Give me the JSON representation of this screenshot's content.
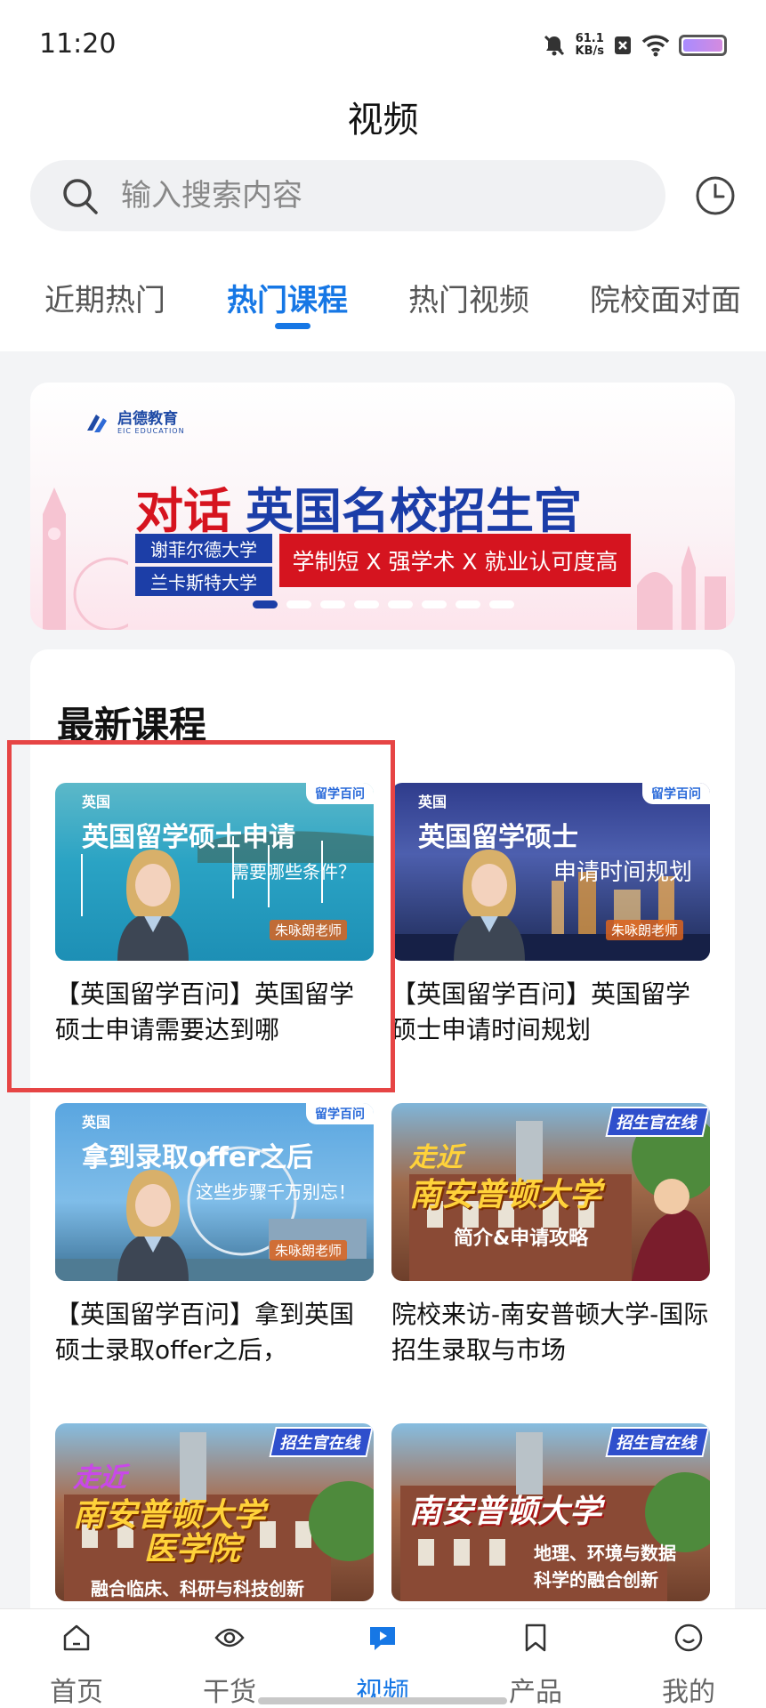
{
  "status_bar": {
    "time": "11:20",
    "net_speed_value": "61.1",
    "net_speed_unit": "KB/s"
  },
  "header": {
    "title": "视频"
  },
  "search": {
    "placeholder": "输入搜索内容"
  },
  "tabs": [
    {
      "label": "近期热门",
      "active": false
    },
    {
      "label": "热门课程",
      "active": true
    },
    {
      "label": "热门视频",
      "active": false
    },
    {
      "label": "院校面对面",
      "active": false
    }
  ],
  "banner": {
    "logo_text": "启德教育",
    "logo_sub": "EIC EDUCATION",
    "headline_red": "对话",
    "headline_blue": "英国名校招生官",
    "schools": [
      "谢菲尔德大学",
      "兰卡斯特大学"
    ],
    "slogan": "学制短 X 强学术 X 就业认可度高",
    "slide_count": 8,
    "active_slide": 1
  },
  "latest": {
    "section_title": "最新课程",
    "courses": [
      {
        "thumb_country": "英国",
        "thumb_corner": "留学百问",
        "thumb_headline": "英国留学硕士申请",
        "thumb_subline": "需要哪些条件？",
        "thumb_teacher": "朱咏朗老师",
        "title": "【英国留学百问】英国留学硕士申请需要达到哪"
      },
      {
        "thumb_country": "英国",
        "thumb_corner": "留学百问",
        "thumb_headline": "英国留学硕士",
        "thumb_subline": "申请时间规划",
        "thumb_teacher": "朱咏朗老师",
        "title": "【英国留学百问】英国留学硕士申请时间规划"
      },
      {
        "thumb_country": "英国",
        "thumb_corner": "留学百问",
        "thumb_headline": "拿到录取offer之后",
        "thumb_subline": "这些步骤千万别忘！",
        "thumb_teacher": "朱咏朗老师",
        "title": "【英国留学百问】拿到英国硕士录取offer之后，"
      },
      {
        "thumb_badge": "招生官在线",
        "thumb_line1": "走近",
        "thumb_line2": "南安普顿大学",
        "thumb_line3": "简介&申请攻略",
        "title": "院校来访-南安普顿大学-国际招生录取与市场"
      },
      {
        "thumb_badge": "招生官在线",
        "thumb_line1": "走近",
        "thumb_line2": "南安普顿大学",
        "thumb_line2b": "医学院",
        "thumb_line3": "融合临床、科研与科技创新"
      },
      {
        "thumb_badge": "招生官在线",
        "thumb_line2": "南安普顿大学",
        "thumb_line3": "地理、环境与数据",
        "thumb_line3b": "科学的融合创新"
      }
    ]
  },
  "bottom_nav": [
    {
      "label": "首页",
      "icon": "home-icon",
      "active": false
    },
    {
      "label": "干货",
      "icon": "eye-icon",
      "active": false
    },
    {
      "label": "视频",
      "icon": "video-chat-icon",
      "active": true
    },
    {
      "label": "产品",
      "icon": "bookmark-icon",
      "active": false
    },
    {
      "label": "我的",
      "icon": "smiley-icon",
      "active": false
    }
  ],
  "colors": {
    "accent": "#1677e5",
    "banner_red": "#d5141f",
    "banner_blue": "#1c3ea7",
    "highlight": "#e64545"
  }
}
